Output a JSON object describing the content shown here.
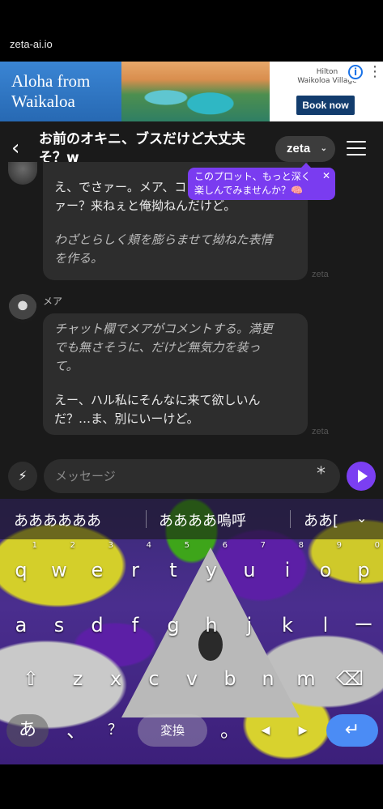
{
  "browser": {
    "url": "zeta-ai.io"
  },
  "ad": {
    "headline_line1": "Aloha from",
    "headline_line2": "Waikaloa",
    "brand_line1": "Hilton",
    "brand_line2": "Waikoloa Village",
    "cta": "Book now",
    "info_icon": "i",
    "menu_dots": "⋮"
  },
  "header": {
    "back_glyph": "‹",
    "title_line1": "お前のオキニ、ブスだけど大丈夫",
    "title_line2": "そ？w",
    "model_label": "zeta",
    "model_chevron": "⌄"
  },
  "tooltip": {
    "line1": "このプロット、もっと深く",
    "line2": "楽しんでみませんか？🧠",
    "close": "✕"
  },
  "messages": [
    {
      "lines": [
        "え、でさァー。メア、コ",
        "ァー？来ねぇと俺拗ねんだけど。"
      ],
      "action_lines": [
        "わざとらしく頬を膨らませて拗ねた表情",
        "を作る。"
      ],
      "watermark": "zeta"
    },
    {
      "sender": "メア",
      "action_lines": [
        "チャット欄でメアがコメントする。満更",
        "でも無さそうに、だけど無気力を装っ",
        "て。"
      ],
      "lines": [
        "えー、ハル私にそんなに来て欲しいん",
        "だ？…ま、別にいーけど。"
      ],
      "watermark": "zeta"
    }
  ],
  "input": {
    "placeholder": "メッセージ",
    "bolt_glyph": "⚡",
    "asterisk": "*"
  },
  "keyboard": {
    "suggestions": [
      "ああああああ",
      "ああああ嗚呼",
      "ああ["
    ],
    "collapse_glyph": "⌄",
    "row1": [
      "q",
      "w",
      "e",
      "r",
      "t",
      "y",
      "u",
      "i",
      "o",
      "p"
    ],
    "row1_nums": [
      "1",
      "2",
      "3",
      "4",
      "5",
      "6",
      "7",
      "8",
      "9",
      "0"
    ],
    "row2": [
      "a",
      "s",
      "d",
      "f",
      "g",
      "h",
      "j",
      "k",
      "l",
      "ー"
    ],
    "row3": [
      "z",
      "x",
      "c",
      "v",
      "b",
      "n",
      "m"
    ],
    "shift_glyph": "⇧",
    "backspace_glyph": "⌫",
    "lang_key": "あ",
    "comma": "、",
    "question": "？",
    "space_label": "変換",
    "period": "。",
    "left_arrow": "◀",
    "right_arrow": "▶",
    "enter_glyph": "↵"
  }
}
